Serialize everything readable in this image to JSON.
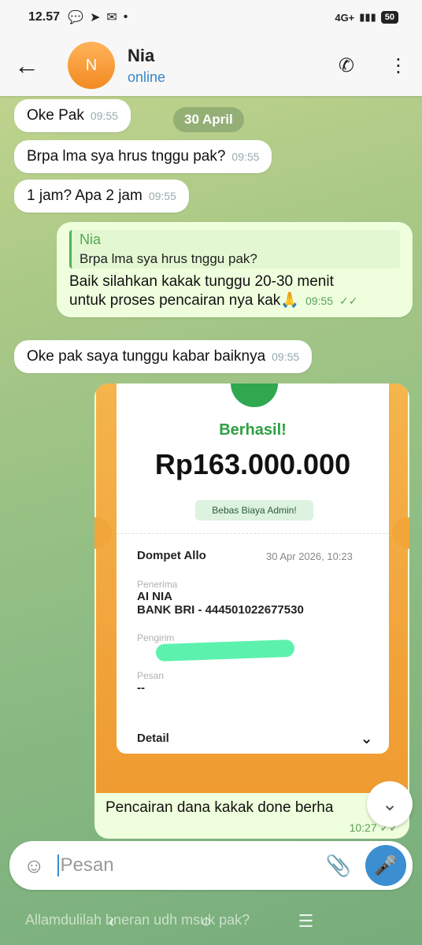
{
  "status_bar": {
    "time": "12.57",
    "network": "4G+",
    "battery": "50"
  },
  "header": {
    "avatar_letter": "N",
    "name": "Nia",
    "status": "online"
  },
  "date_pill": "30 April",
  "messages": [
    {
      "text": "Oke Pak",
      "time": "09:55"
    },
    {
      "text": "Brpa lma sya hrus tnggu pak?",
      "time": "09:55"
    },
    {
      "text": "1 jam? Apa 2 jam",
      "time": "09:55"
    },
    {
      "quote_name": "Nia",
      "quote_text": "Brpa lma sya hrus tnggu pak?",
      "text_line1": "Baik silahkan kakak tunggu 20-30 menit",
      "text_line2": "untuk proses pencairan nya kak",
      "emoji": "🙏",
      "time": "09:55"
    },
    {
      "text": "Oke pak saya tunggu kabar baiknya",
      "time": "09:55"
    }
  ],
  "receipt": {
    "status": "Berhasil!",
    "amount": "Rp163.000.000",
    "badge": "Bebas Biaya Admin!",
    "source": "Dompet Allo",
    "datetime": "30 Apr 2026, 10:23",
    "recipient_label": "Penerima",
    "recipient_name": "AI NIA",
    "recipient_bank": "BANK BRI - 444501022677530",
    "sender_label": "Pengirim",
    "message_label": "Pesan",
    "message_value": "--",
    "detail_label": "Detail"
  },
  "photo_message": {
    "caption": "Pencairan dana kakak done berha",
    "time": "10:27"
  },
  "composer": {
    "placeholder": "Pesan"
  },
  "ghost_text": "Allamdulilah bneran udh msuk pak?"
}
